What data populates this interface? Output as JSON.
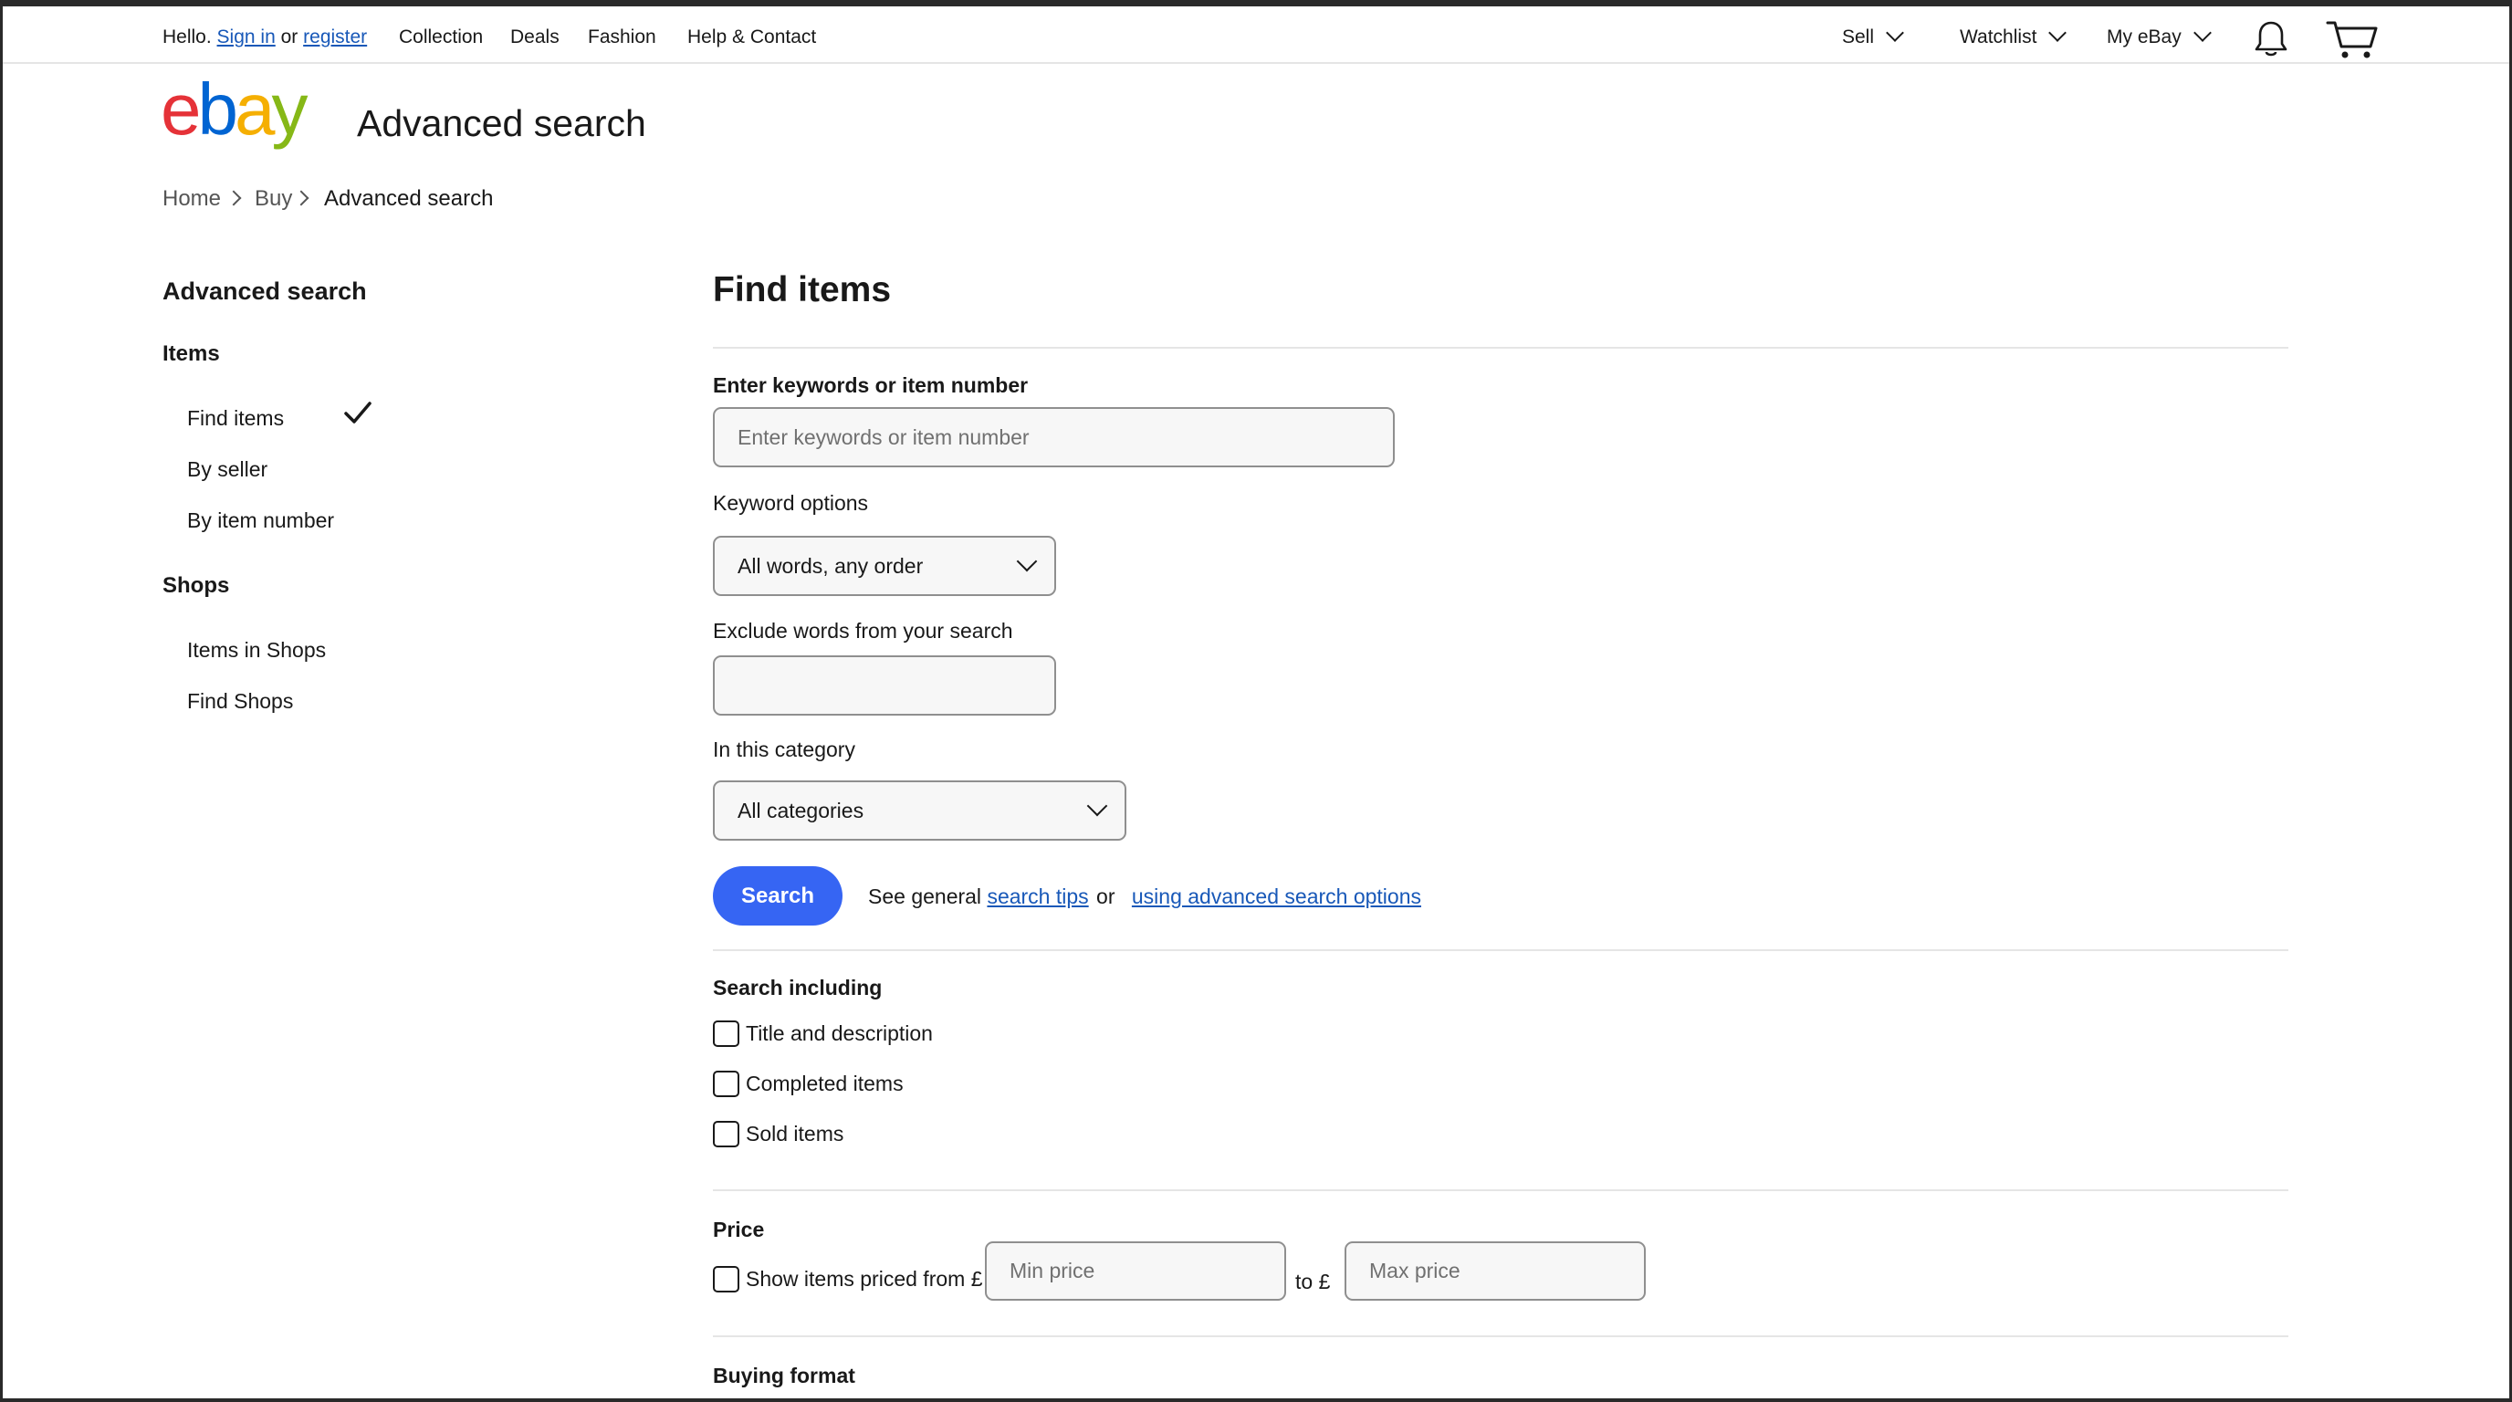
{
  "topnav": {
    "hello": "Hello.",
    "sign_in": "Sign in",
    "or": "or",
    "register": "register",
    "links": [
      "Collection",
      "Deals",
      "Fashion",
      "Help & Contact"
    ],
    "sell": "Sell",
    "watchlist": "Watchlist",
    "my_ebay": "My eBay",
    "icons": [
      "bell-icon",
      "cart-icon"
    ]
  },
  "header": {
    "logo": {
      "e": "e",
      "b": "b",
      "a": "a",
      "y": "y"
    },
    "title": "Advanced search"
  },
  "breadcrumb": [
    "Home",
    "Buy",
    "Advanced search"
  ],
  "sidebar": {
    "heading": "Advanced search",
    "sections": [
      {
        "title": "Items",
        "items": [
          "Find items",
          "By seller",
          "By item number"
        ]
      },
      {
        "title": "Shops",
        "items": [
          "Items in Shops",
          "Find Shops"
        ]
      }
    ],
    "selected": "Find items"
  },
  "main": {
    "title": "Find items",
    "keywords_label": "Enter keywords or item number",
    "keywords_placeholder": "Enter keywords or item number",
    "keyword_options_label": "Keyword options",
    "keyword_options_value": "All words, any order",
    "exclude_label": "Exclude words from your search",
    "category_label": "In this category",
    "category_value": "All categories",
    "search_button": "Search",
    "tips_prefix": "See general",
    "tips_link": "search tips",
    "tips_or": "or",
    "advanced_link": "using advanced search options",
    "search_including_label": "Search including",
    "search_including_options": [
      "Title and description",
      "Completed items",
      "Sold items"
    ],
    "price_label": "Price",
    "price_checkbox": "Show items priced from £",
    "min_price_placeholder": "Min price",
    "price_to": "to £",
    "max_price_placeholder": "Max price",
    "buying_format_label": "Buying format"
  },
  "colors": {
    "accent": "#3665f3",
    "link": "#1858b8",
    "logo_e": "#e53238",
    "logo_b": "#0064d2",
    "logo_a": "#f5af02",
    "logo_y": "#86b817"
  }
}
